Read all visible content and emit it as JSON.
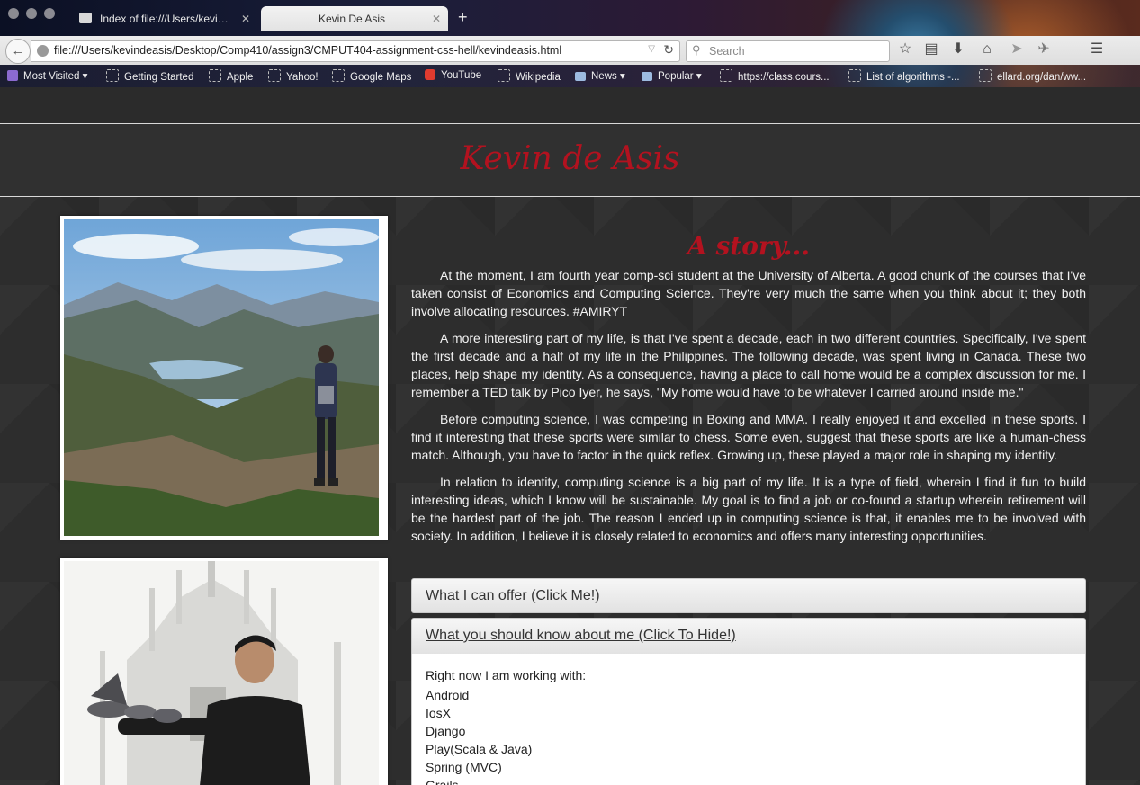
{
  "browser": {
    "tabs": [
      {
        "title": "Index of file:///Users/kevind...",
        "active": false
      },
      {
        "title": "Kevin De Asis",
        "active": true
      }
    ],
    "url": "file:///Users/kevindeasis/Desktop/Comp410/assign3/CMPUT404-assignment-css-hell/kevindeasis.html",
    "search_placeholder": "Search",
    "bookmarks": [
      {
        "label": "Most Visited",
        "icon": "most-visited-icon"
      },
      {
        "label": "Getting Started",
        "icon": "page-icon"
      },
      {
        "label": "Apple",
        "icon": "page-icon"
      },
      {
        "label": "Yahoo!",
        "icon": "page-icon"
      },
      {
        "label": "Google Maps",
        "icon": "page-icon"
      },
      {
        "label": "YouTube",
        "icon": "youtube-icon"
      },
      {
        "label": "Wikipedia",
        "icon": "page-icon"
      },
      {
        "label": "News",
        "icon": "folder-icon"
      },
      {
        "label": "Popular",
        "icon": "folder-icon"
      },
      {
        "label": "https://class.cours...",
        "icon": "page-icon"
      },
      {
        "label": "List of algorithms -...",
        "icon": "page-icon"
      },
      {
        "label": "ellard.org/dan/ww...",
        "icon": "page-icon"
      }
    ]
  },
  "page": {
    "title": "Kevin de Asis",
    "story_heading": "A story...",
    "paragraphs": [
      "At the moment, I am fourth year comp-sci student at the University of Alberta. A good chunk of the courses that I've taken consist of Economics and Computing Science. They're very much the same when you think about it; they both involve allocating resources. #AMIRYT",
      "A more interesting part of my life, is that I've spent a decade, each in two different countries. Specifically, I've spent the first decade and a half of my life in the Philippines. The following decade, was spent living in Canada. These two places, help shape my identity. As a consequence, having a place to call home would be a complex discussion for me. I remember a TED talk by Pico Iyer, he says, \"My home would have to be whatever I carried around inside me.\"",
      "Before computing science, I was competing in Boxing and MMA. I really enjoyed it and excelled in these sports. I find it interesting that these sports were similar to chess. Some even, suggest that these sports are like a human-chess match. Although, you have to factor in the quick reflex. Growing up, these played a major role in shaping my identity.",
      "In relation to identity, computing science is a big part of my life. It is a type of field, wherein I find it fun to build interesting ideas, which I know will be sustainable. My goal is to find a job or co-found a startup wherein retirement will be the hardest part of the job. The reason I ended up in computing science is that, it enables me to be involved with society. In addition, I believe it is closely related to economics and offers many interesting opportunities."
    ],
    "accordion": {
      "offer_label": "What I can offer (Click Me!)",
      "know_label": "What you should know about me (Click To Hide!)",
      "intro": "Right now I am working with:",
      "items": [
        "Android",
        "IosX",
        "Django",
        "Play(Scala & Java)",
        "Spring (MVC)",
        "Grails"
      ]
    }
  },
  "colors": {
    "title_red": "#b3121f",
    "page_bg": "#2d2d2d"
  }
}
